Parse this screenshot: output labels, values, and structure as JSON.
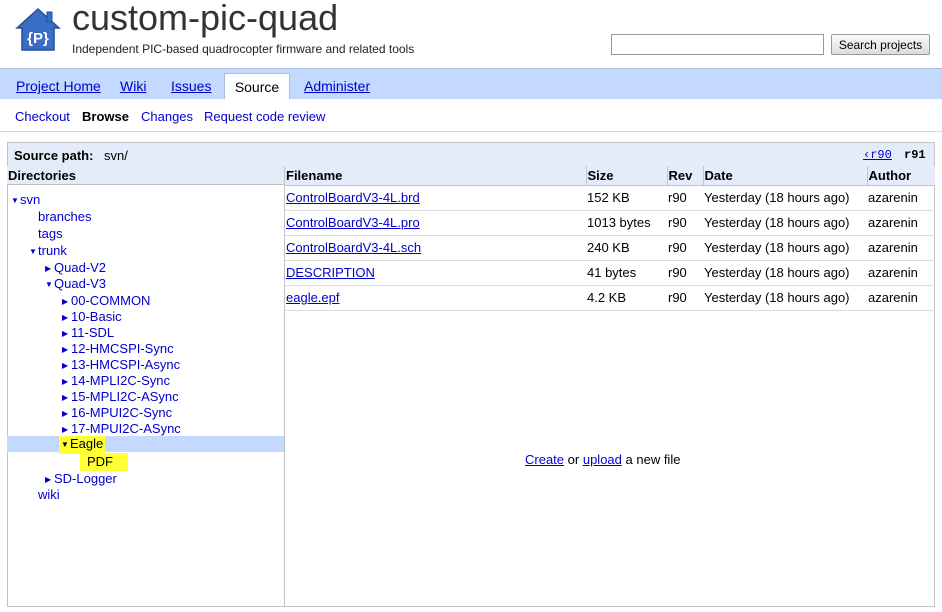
{
  "header": {
    "project_name": "custom-pic-quad",
    "project_summary": "Independent PIC-based quadrocopter firmware and related tools",
    "logo_letter": "{P}",
    "search_button": "Search projects",
    "search_value": ""
  },
  "main_tabs": [
    "Project Home",
    "Wiki",
    "Issues",
    "Source",
    "Administer"
  ],
  "sub_nav": [
    "Checkout",
    "Browse",
    "Changes",
    "Request code review"
  ],
  "source_path": {
    "label": "Source path:",
    "value": "svn/",
    "prev_rev": "‹r90",
    "current_rev": "r91"
  },
  "directories": {
    "header": "Directories",
    "items": [
      "svn",
      "branches",
      "tags",
      "trunk",
      "Quad-V2",
      "Quad-V3",
      "00-COMMON",
      "10-Basic",
      "11-SDL",
      "12-HMCSPI-Sync",
      "13-HMCSPI-Async",
      "14-MPLI2C-Sync",
      "15-MPLI2C-ASync",
      "16-MPUI2C-Sync",
      "17-MPUI2C-ASync",
      "Eagle",
      "PDF",
      "SD-Logger",
      "wiki"
    ]
  },
  "files": {
    "columns": [
      "Filename",
      "Size",
      "Rev",
      "Date",
      "Author"
    ],
    "rows": [
      [
        "ControlBoardV3-4L.brd",
        "152 KB",
        "r90",
        "Yesterday (18 hours ago)",
        "azarenin"
      ],
      [
        "ControlBoardV3-4L.pro",
        "1013 bytes",
        "r90",
        "Yesterday (18 hours ago)",
        "azarenin"
      ],
      [
        "ControlBoardV3-4L.sch",
        "240 KB",
        "r90",
        "Yesterday (18 hours ago)",
        "azarenin"
      ],
      [
        "DESCRIPTION",
        "41 bytes",
        "r90",
        "Yesterday (18 hours ago)",
        "azarenin"
      ],
      [
        "eagle.epf",
        "4.2 KB",
        "r90",
        "Yesterday (18 hours ago)",
        "azarenin"
      ]
    ]
  },
  "empty_message": {
    "create": "Create",
    "or": "or",
    "upload": "upload",
    "rest": "a new file"
  },
  "colors": {
    "tab_bar": "#c3d9ff",
    "header_bg": "#e5ecf9",
    "link": "#0000cc",
    "highlight": "#ffff33",
    "logo": "#3a6ec6"
  }
}
